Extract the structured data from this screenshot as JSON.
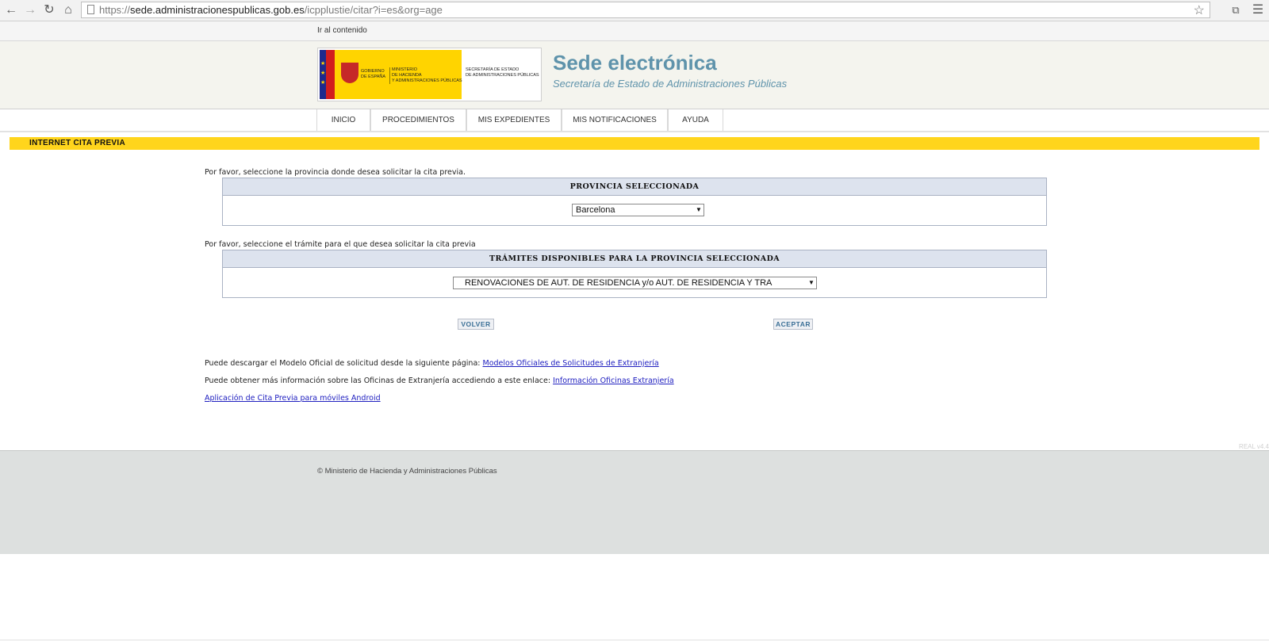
{
  "browser": {
    "url_prefix": "https://",
    "url_host": "sede.administracionespublicas.gob.es",
    "url_path": "/icpplustie/citar?i=es&org=age"
  },
  "skip_link": "Ir al contenido",
  "header": {
    "logo": {
      "gobierno": "GOBIERNO\nDE ESPAÑA",
      "ministerio": "MINISTERIO\nDE HACIENDA\nY ADMINISTRACIONES PÚBLICAS",
      "secretaria": "SECRETARÍA DE ESTADO\nDE ADMINISTRACIONES PÚBLICAS"
    },
    "title": "Sede electrónica",
    "subtitle": "Secretaría de Estado de Administraciones Públicas"
  },
  "nav": {
    "items": [
      "INICIO",
      "PROCEDIMIENTOS",
      "MIS EXPEDIENTES",
      "MIS NOTIFICACIONES",
      "AYUDA"
    ]
  },
  "section_title": "INTERNET CITA PREVIA",
  "form": {
    "province_instruction": "Por favor, seleccione la provincia donde desea solicitar la cita previa.",
    "province_header": "PROVINCIA SELECCIONADA",
    "province_value": "Barcelona",
    "tramite_instruction": "Por favor, seleccione el trámite para el que desea solicitar la cita previa",
    "tramite_header": "TRÁMITES DISPONIBLES PARA LA PROVINCIA SELECCIONADA",
    "tramite_value": "RENOVACIONES DE AUT. DE RESIDENCIA y/o AUT. DE RESIDENCIA Y TRA",
    "back_button": "VOLVER",
    "accept_button": "ACEPTAR"
  },
  "info": {
    "models_text": "Puede descargar el Modelo Oficial de solicitud desde la siguiente página:",
    "models_link": " Modelos Oficiales de Solicitudes de Extranjería",
    "offices_text": "Puede obtener más información sobre las Oficinas de Extranjería accediendo a este enlace:",
    "offices_link": "Información Oficinas Extranjería",
    "android_link": "Aplicación de Cita Previa para móviles Android"
  },
  "version": "REAL v4.4",
  "footer": "© Ministerio de Hacienda y Administraciones Públicas"
}
